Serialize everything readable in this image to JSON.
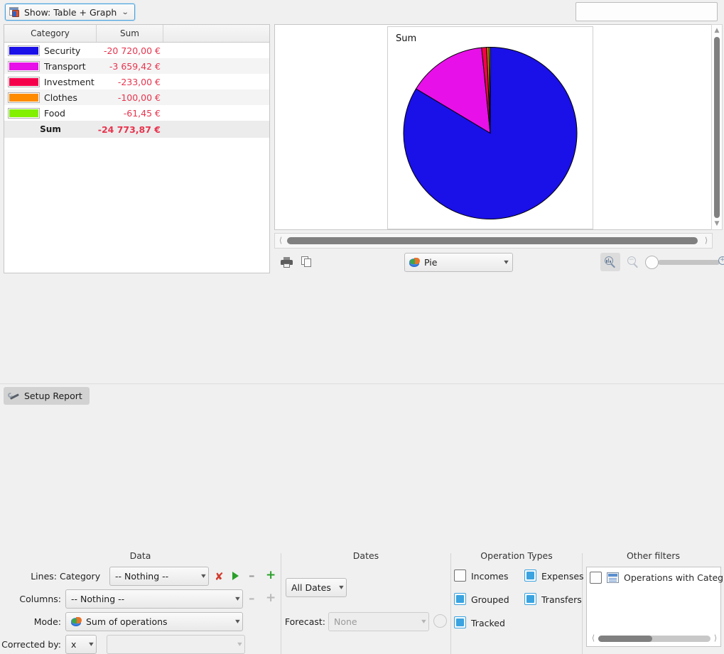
{
  "topbar": {
    "show_button_label": "Show: Table + Graph",
    "show_button_icon": "table-graph-icon",
    "chevron": "⌄",
    "search_value": "",
    "search_placeholder": ""
  },
  "table": {
    "columns": [
      "Category",
      "Sum",
      ""
    ],
    "rows": [
      {
        "color": "#1a10e8",
        "category": "Security",
        "sum": "-20 720,00 €"
      },
      {
        "color": "#e810e8",
        "category": "Transport",
        "sum": "-3 659,42 €"
      },
      {
        "color": "#f5004b",
        "category": "Investment",
        "sum": "-233,00 €"
      },
      {
        "color": "#ff8c00",
        "category": "Clothes",
        "sum": "-100,00 €"
      },
      {
        "color": "#82f000",
        "category": "Food",
        "sum": "-61,45 €"
      }
    ],
    "total_label": "Sum",
    "total_value": "-24 773,87 €",
    "value_color": "#e8344e"
  },
  "chart_data": {
    "type": "pie",
    "title": "Sum",
    "categories": [
      "Security",
      "Transport",
      "Investment",
      "Clothes",
      "Food"
    ],
    "values": [
      -20720.0,
      -3659.42,
      -233.0,
      -100.0,
      -61.45
    ],
    "absolute_values": [
      20720.0,
      3659.42,
      233.0,
      100.0,
      61.45
    ],
    "percentages": [
      83.6,
      14.8,
      0.94,
      0.4,
      0.25
    ],
    "colors": [
      "#1a10e8",
      "#e810e8",
      "#f5004b",
      "#ff8c00",
      "#82f000"
    ],
    "total": -24773.87,
    "start_angle_deg": -90,
    "direction": "clockwise",
    "legend": "none",
    "grid": false,
    "xlabel": "",
    "ylabel": ""
  },
  "graph_toolbar": {
    "print_icon": "printer-icon",
    "copy_icon": "copy-icon",
    "type_value": "Pie",
    "type_icon": "pie-3d-icon",
    "fit_icon": "zoom-fit-icon",
    "zoom_out_icon": "zoom-out-icon",
    "zoom_in_icon": "zoom-in-icon",
    "zoom_slider_value": 0
  },
  "settings": {
    "data": {
      "title": "Data",
      "lines_label": "Lines:",
      "lines_field_label": "Category",
      "lines_value": "-- Nothing --",
      "delete_icon": "delete-x-icon",
      "run_icon": "play-icon",
      "minus_icon": "minus-icon",
      "plus_icon": "plus-icon",
      "columns_label": "Columns:",
      "columns_value": "-- Nothing --",
      "mode_label": "Mode:",
      "mode_value": "Sum of operations",
      "mode_icon": "pie-3d-icon",
      "corrected_label": "Corrected by:",
      "corrected_value": "x",
      "corrected_secondary_value": ""
    },
    "dates": {
      "title": "Dates",
      "range_value": "All Dates",
      "forecast_label": "Forecast:",
      "forecast_value": "None"
    },
    "operation_types": {
      "title": "Operation Types",
      "items": [
        {
          "label": "Incomes",
          "checked": false
        },
        {
          "label": "Expenses",
          "checked": true
        },
        {
          "label": "Grouped",
          "checked": true
        },
        {
          "label": "Transfers",
          "checked": true
        },
        {
          "label": "Tracked",
          "checked": true
        }
      ],
      "accent": "#3aa3e0"
    },
    "other_filters": {
      "title": "Other filters",
      "items": [
        {
          "label": "Operations with Categ",
          "checked": false,
          "icon": "document-icon"
        }
      ]
    }
  },
  "statusbar": {
    "setup_label": "Setup Report",
    "setup_icon": "wrench-icon"
  }
}
